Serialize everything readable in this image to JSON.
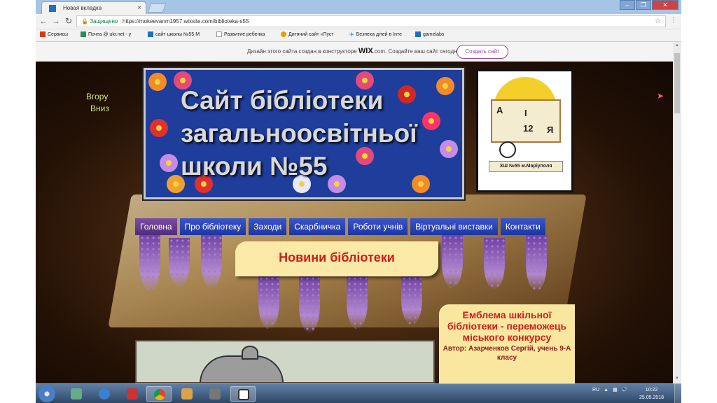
{
  "browser": {
    "tab_title": "Новая вкладка",
    "tab_close": "×",
    "url_secure": "Защищено",
    "url": "https://mokeevanm1957.wixsite.com/biblioteka-s55",
    "bookmarks": [
      {
        "label": "Сервисы",
        "icon": "apps-grid-icon",
        "color": "#d83b01"
      },
      {
        "label": "Почта @ ukr.net - у",
        "icon": "mail-icon",
        "color": "#2e8b57"
      },
      {
        "label": "сайт школы №55 M",
        "icon": "wix-icon",
        "color": "#1f6fc4"
      },
      {
        "label": "Развитие ребенка",
        "icon": "page-icon",
        "color": "#999999"
      },
      {
        "label": "Дитячий сайт «Пуст",
        "icon": "bird-icon",
        "color": "#f29a00"
      },
      {
        "label": "Безпека дітей в Інте",
        "icon": "plane-icon",
        "color": "#1f6fc4"
      },
      {
        "label": "gamelabs",
        "icon": "wix-icon",
        "color": "#1f6fc4"
      }
    ]
  },
  "wix_banner": {
    "text_before": "Дизайн этого сайта создан в конструкторе ",
    "brand": "WIX",
    "text_after": ".com. Создайте ваш сайт сегодня.",
    "button": "Создать сайт"
  },
  "site": {
    "side_up": "Вгору",
    "side_down": "Вниз",
    "title": "Сайт бібліотеки загальноосвітньої школи №55",
    "emblem": {
      "letters": [
        "А",
        "І",
        "12",
        "Я"
      ],
      "ribbon": "ЗШ №55 м.Маріуполя"
    },
    "nav": [
      "Головна",
      "Про бібліотеку",
      "Заходи",
      "Скарбничка",
      "Роботи учнів",
      "Віртуальні виставки",
      "Контакти"
    ],
    "news_heading": "Новини бібліотеки",
    "emblem_panel": {
      "title": "Емблема шкільної бібліотеки - переможець міського конкурсу",
      "author": "Автор: Азарченков Сергій, учень 9-А класу"
    }
  },
  "taskbar": {
    "lang": "RU",
    "time": "10:22",
    "date": "25.05.2018"
  },
  "colors": {
    "hero_bg": "#1f3d9a",
    "nav_bg": "#1d36a0",
    "nav_active": "#4f2c7a",
    "heading_red": "#d21a1a",
    "panel_bg": "#f9e7a0"
  }
}
